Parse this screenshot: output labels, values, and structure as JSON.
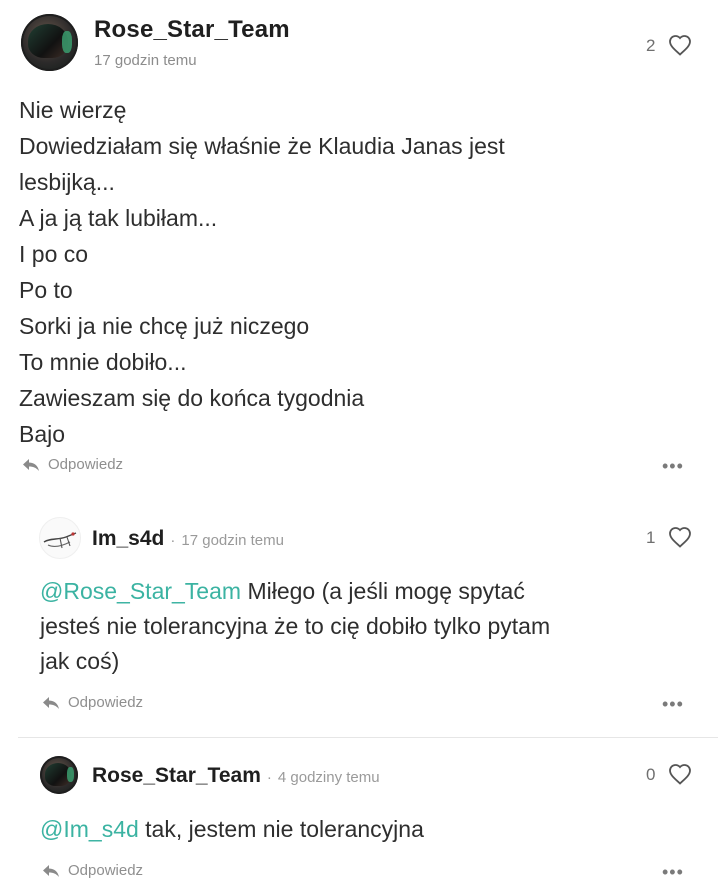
{
  "post": {
    "author": "Rose_Star_Team",
    "time": "17 godzin temu",
    "likes": "2",
    "lines": [
      "Nie wierzę",
      "Dowiedziałam się właśnie że Klaudia Janas jest",
      "lesbijką...",
      "A ja ją tak lubiłam...",
      "I po co",
      "Po to",
      "Sorki ja nie chcę już niczego",
      "To mnie dobiło...",
      "Zawieszam się do końca tygodnia",
      "Bajo"
    ],
    "reply_label": "Odpowiedz",
    "more_label": "•••"
  },
  "comments": [
    {
      "author": "Im_s4d",
      "separator": "·",
      "time": "17 godzin temu",
      "likes": "1",
      "mention": "@Rose_Star_Team",
      "lines": [
        " Miłego (a jeśli mogę spytać",
        "jesteś nie tolerancyjna że to cię dobiło tylko pytam",
        "jak coś)"
      ],
      "reply_label": "Odpowiedz",
      "more_label": "•••"
    },
    {
      "author": "Rose_Star_Team",
      "separator": "·",
      "time": "4 godziny temu",
      "likes": "0",
      "mention": "@Im_s4d",
      "lines": [
        " tak, jestem nie tolerancyjna"
      ],
      "reply_label": "Odpowiedz",
      "more_label": "•••"
    }
  ],
  "colors": {
    "mention": "#3bb3a2",
    "text": "#2e2e2e",
    "meta": "#8c8c8c"
  },
  "icons": {
    "like": "heart-outline-icon",
    "reply": "reply-arrow-icon",
    "more": "ellipsis-icon"
  }
}
